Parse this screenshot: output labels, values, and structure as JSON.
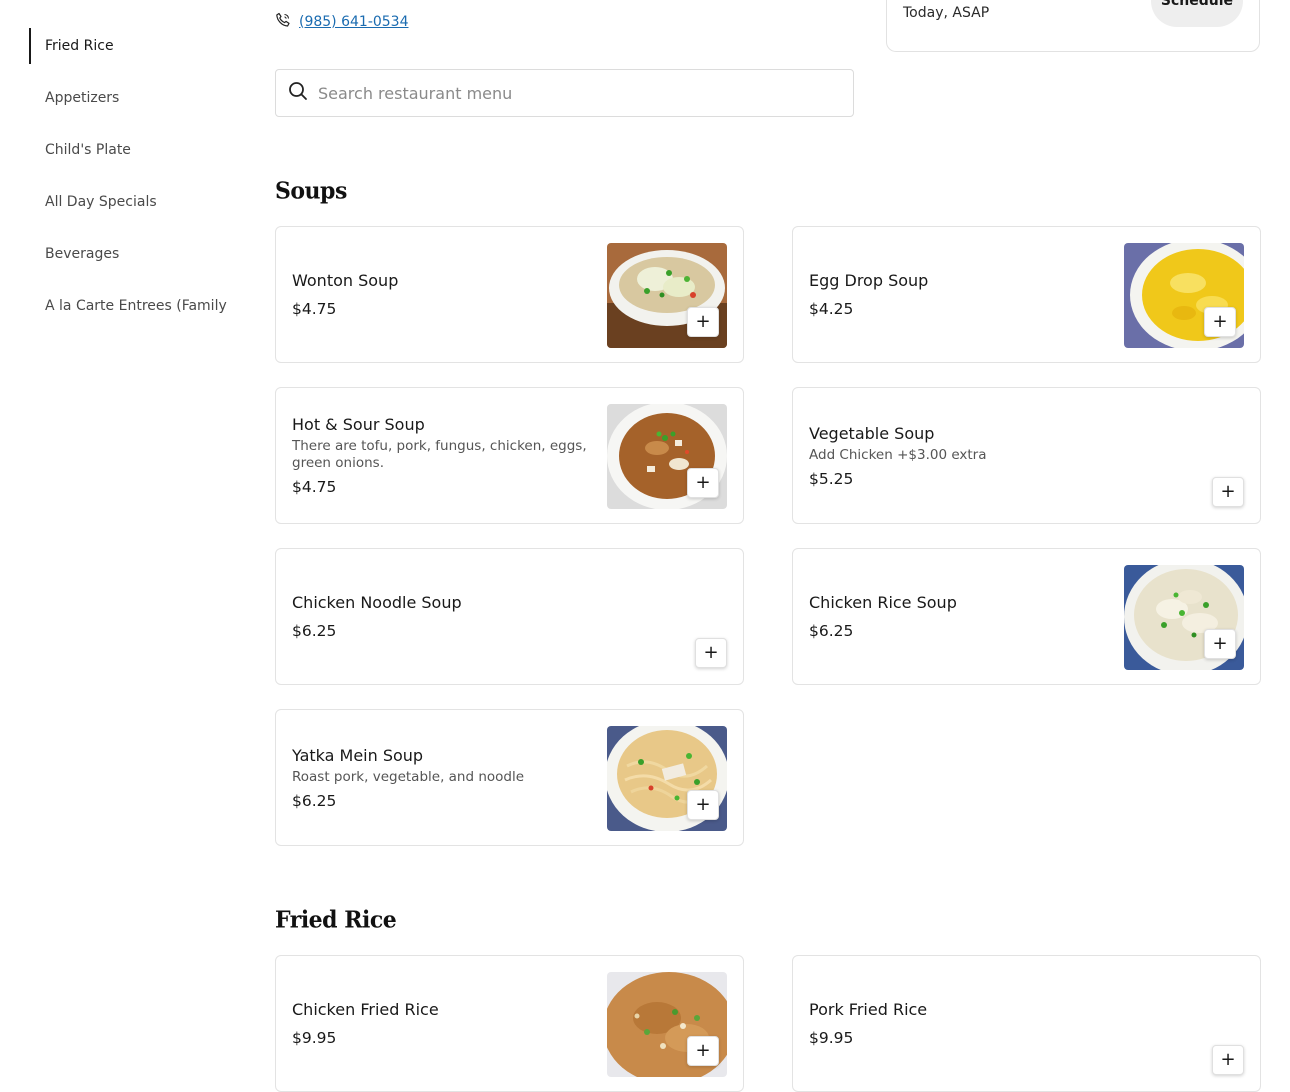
{
  "sidebar": {
    "items": [
      {
        "label": "Fried Rice",
        "active": true
      },
      {
        "label": "Appetizers",
        "active": false
      },
      {
        "label": "Child's Plate",
        "active": false
      },
      {
        "label": "All Day Specials",
        "active": false
      },
      {
        "label": "Beverages",
        "active": false
      },
      {
        "label": "A la Carte Entrees (Family",
        "active": false
      }
    ]
  },
  "header": {
    "phone": "(985) 641-0534",
    "schedule": {
      "time_label": "Today, ASAP",
      "button_label": "Schedule"
    }
  },
  "search": {
    "placeholder": "Search restaurant menu",
    "value": ""
  },
  "sections": [
    {
      "title": "Soups",
      "items": [
        {
          "name": "Wonton Soup",
          "price": "$4.75",
          "has_image": true,
          "image": "wonton-soup-photo"
        },
        {
          "name": "Egg Drop Soup",
          "price": "$4.25",
          "has_image": true,
          "image": "egg-drop-soup-photo"
        },
        {
          "name": "Hot & Sour Soup",
          "description": "There are tofu, pork, fungus, chicken, eggs, green onions.",
          "price": "$4.75",
          "has_image": true,
          "image": "hot-sour-soup-photo"
        },
        {
          "name": "Vegetable Soup",
          "description": "Add Chicken +$3.00 extra",
          "price": "$5.25",
          "has_image": false
        },
        {
          "name": "Chicken Noodle Soup",
          "price": "$6.25",
          "has_image": false
        },
        {
          "name": "Chicken Rice Soup",
          "price": "$6.25",
          "has_image": true,
          "image": "chicken-rice-soup-photo"
        },
        {
          "name": "Yatka Mein Soup",
          "description": "Roast pork, vegetable, and noodle",
          "price": "$6.25",
          "has_image": true,
          "image": "yatka-mein-soup-photo"
        }
      ]
    },
    {
      "title": "Fried Rice",
      "items": [
        {
          "name": "Chicken Fried Rice",
          "price": "$9.95",
          "has_image": true,
          "image": "chicken-fried-rice-photo"
        },
        {
          "name": "Pork Fried Rice",
          "price": "$9.95",
          "has_image": false
        }
      ]
    }
  ],
  "add_button_glyph": "+",
  "colors": {
    "link": "#1a6bb0",
    "border": "#e3e3e3",
    "schedule_button_bg": "#eeeeee"
  }
}
